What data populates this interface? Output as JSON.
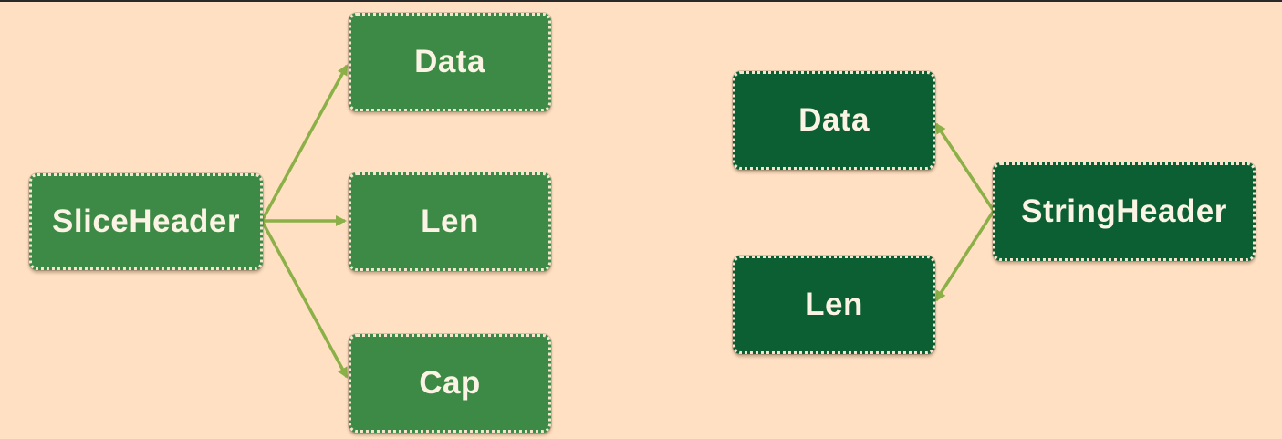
{
  "colors": {
    "background": "#ffe0c2",
    "slice_nodes": "#3c8a46",
    "string_nodes": "#0c5f33",
    "edge": "#8cb048",
    "text": "#fbf3e4"
  },
  "slice_diagram": {
    "root": "SliceHeader",
    "fields": [
      "Data",
      "Len",
      "Cap"
    ]
  },
  "string_diagram": {
    "root": "StringHeader",
    "fields": [
      "Data",
      "Len"
    ]
  }
}
